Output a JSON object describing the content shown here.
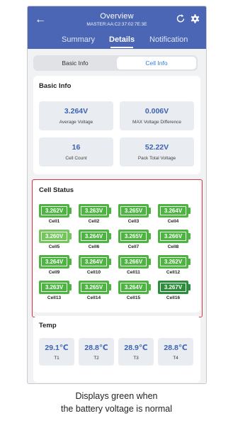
{
  "header": {
    "title": "Overview",
    "subtitle": "MASTER:AA:C2:37:02:7E:3E",
    "back_icon": "arrow-left-icon",
    "refresh_icon": "refresh-icon",
    "settings_icon": "gear-icon",
    "tabs": [
      {
        "label": "Summary"
      },
      {
        "label": "Details",
        "active": true
      },
      {
        "label": "Notification"
      }
    ]
  },
  "segment": {
    "items": [
      {
        "label": "Basic Info"
      },
      {
        "label": "Cell Info",
        "selected": true
      }
    ]
  },
  "basic_info": {
    "title": "Basic Info",
    "stats": [
      {
        "value": "3.264V",
        "label": "Average Voltage"
      },
      {
        "value": "0.006V",
        "label": "MAX Voltage Difference"
      },
      {
        "value": "16",
        "label": "Cell Count"
      },
      {
        "value": "52.22V",
        "label": "Pack Total Voltage"
      }
    ]
  },
  "cell_status": {
    "title": "Cell Status",
    "cells": [
      {
        "voltage": "3.262V",
        "name": "Cell1"
      },
      {
        "voltage": "3.263V",
        "name": "Cell2"
      },
      {
        "voltage": "3.265V",
        "name": "Cell3"
      },
      {
        "voltage": "3.264V",
        "name": "Cell4"
      },
      {
        "voltage": "3.260V",
        "name": "Cell5",
        "shade": "light"
      },
      {
        "voltage": "3.264V",
        "name": "Cell6"
      },
      {
        "voltage": "3.265V",
        "name": "Cell7"
      },
      {
        "voltage": "3.266V",
        "name": "Cell8"
      },
      {
        "voltage": "3.264V",
        "name": "Cell9"
      },
      {
        "voltage": "3.264V",
        "name": "Cell10"
      },
      {
        "voltage": "3.266V",
        "name": "Cell11"
      },
      {
        "voltage": "3.262V",
        "name": "Cell12"
      },
      {
        "voltage": "3.263V",
        "name": "Cell13"
      },
      {
        "voltage": "3.265V",
        "name": "Cell14"
      },
      {
        "voltage": "3.264V",
        "name": "Cell15"
      },
      {
        "voltage": "3.267V",
        "name": "Cell16",
        "shade": "dark"
      }
    ],
    "highlight_color": "#d8373e"
  },
  "temp": {
    "title": "Temp",
    "items": [
      {
        "value": "29.1℃",
        "label": "T1"
      },
      {
        "value": "28.8℃",
        "label": "T2"
      },
      {
        "value": "28.9℃",
        "label": "T3"
      },
      {
        "value": "28.8℃",
        "label": "T4"
      }
    ]
  },
  "caption": {
    "line1": "Displays green when",
    "line2": "the battery voltage is normal"
  },
  "colors": {
    "header_bg": "#4a66b4",
    "accent_blue": "#3d63b3",
    "battery_green": "#4cb53f"
  }
}
